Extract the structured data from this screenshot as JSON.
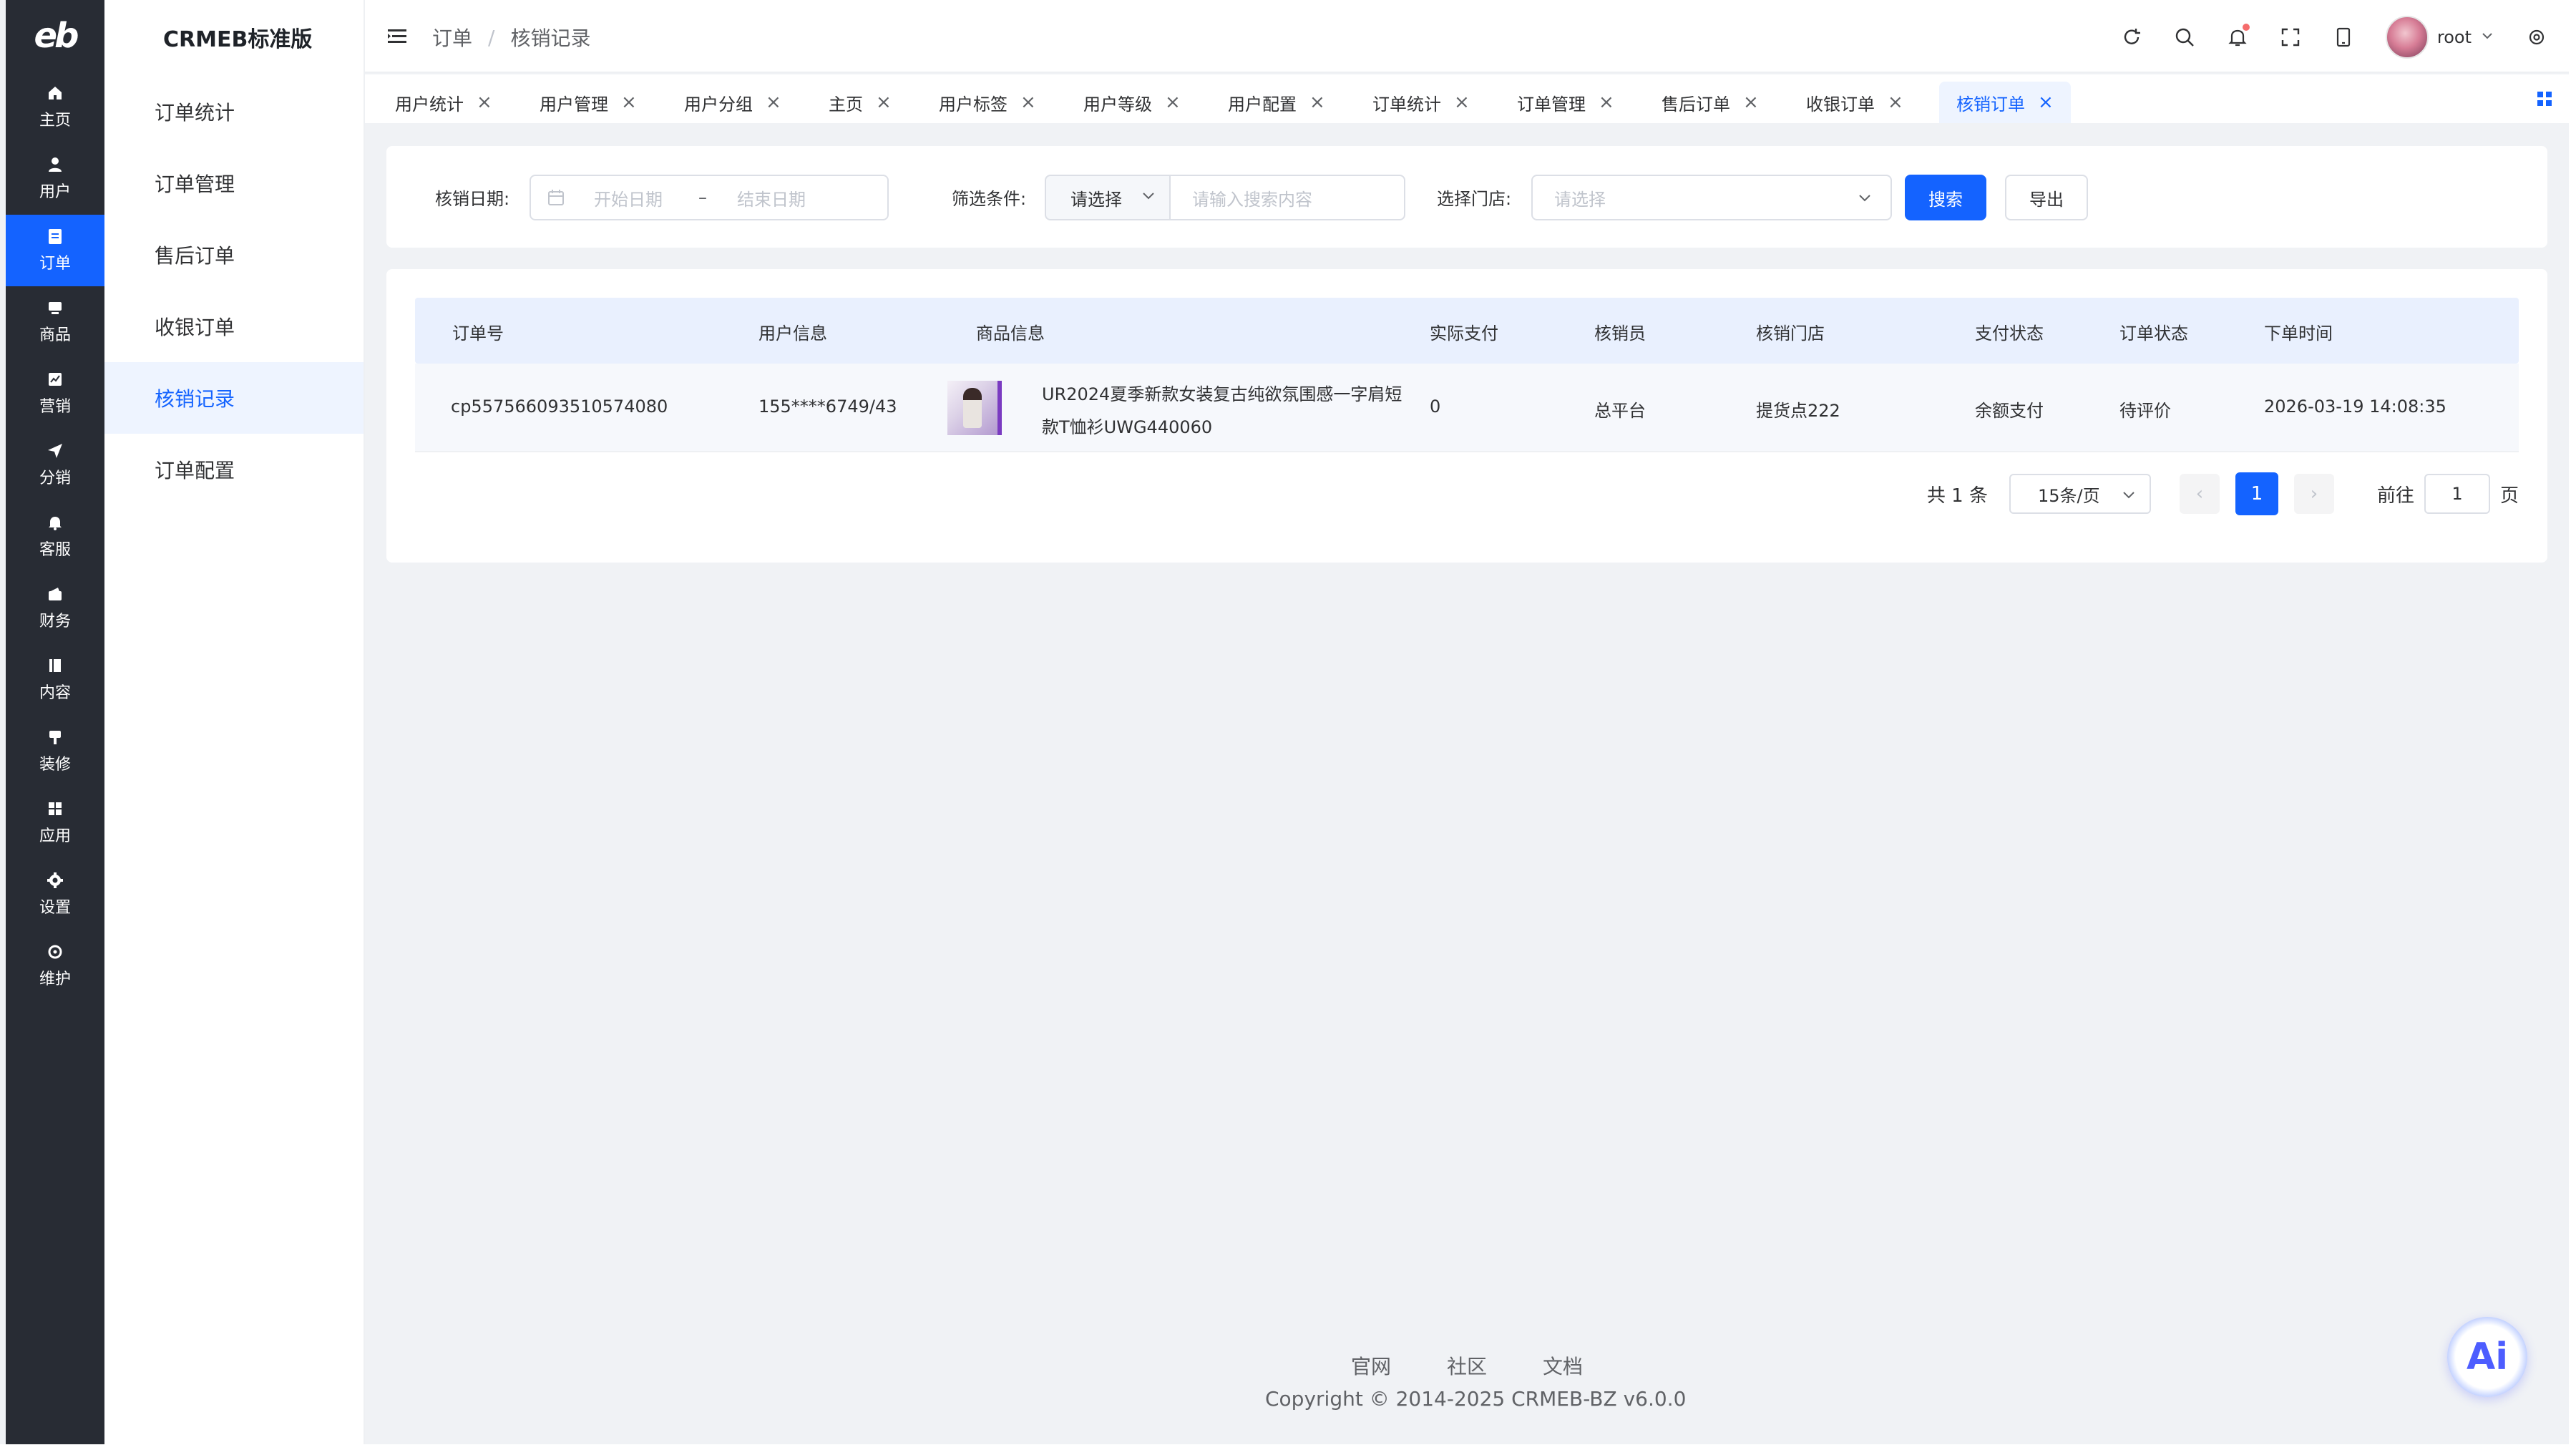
{
  "brand": {
    "logo_text": "eb",
    "title": "CRMEB标准版"
  },
  "rail": [
    {
      "label": "主页",
      "icon": "home-icon"
    },
    {
      "label": "用户",
      "icon": "user-icon"
    },
    {
      "label": "订单",
      "icon": "order-icon",
      "active": true
    },
    {
      "label": "商品",
      "icon": "product-icon"
    },
    {
      "label": "营销",
      "icon": "marketing-icon"
    },
    {
      "label": "分销",
      "icon": "send-icon"
    },
    {
      "label": "客服",
      "icon": "bell-icon"
    },
    {
      "label": "财务",
      "icon": "finance-icon"
    },
    {
      "label": "内容",
      "icon": "content-icon"
    },
    {
      "label": "装修",
      "icon": "decorate-icon"
    },
    {
      "label": "应用",
      "icon": "apps-icon"
    },
    {
      "label": "设置",
      "icon": "settings-icon"
    },
    {
      "label": "维护",
      "icon": "maintain-icon"
    }
  ],
  "subnav": [
    {
      "label": "订单统计"
    },
    {
      "label": "订单管理"
    },
    {
      "label": "售后订单"
    },
    {
      "label": "收银订单"
    },
    {
      "label": "核销记录",
      "active": true
    },
    {
      "label": "订单配置"
    }
  ],
  "breadcrumb": {
    "parent": "订单",
    "separator": "/",
    "current": "核销记录"
  },
  "header": {
    "username": "root"
  },
  "tabs": [
    {
      "label": "用户统计"
    },
    {
      "label": "用户管理"
    },
    {
      "label": "用户分组"
    },
    {
      "label": "主页"
    },
    {
      "label": "用户标签"
    },
    {
      "label": "用户等级"
    },
    {
      "label": "用户配置"
    },
    {
      "label": "订单统计"
    },
    {
      "label": "订单管理"
    },
    {
      "label": "售后订单"
    },
    {
      "label": "收银订单"
    },
    {
      "label": "核销订单",
      "active": true
    }
  ],
  "filters": {
    "date_label": "核销日期:",
    "start_placeholder": "开始日期",
    "range_separator": "–",
    "end_placeholder": "结束日期",
    "condition_label": "筛选条件:",
    "condition_value": "请选择",
    "search_placeholder": "请输入搜索内容",
    "store_label": "选择门店:",
    "store_placeholder": "请选择",
    "search_button": "搜索",
    "export_button": "导出"
  },
  "table": {
    "columns": [
      "订单号",
      "用户信息",
      "商品信息",
      "实际支付",
      "核销员",
      "核销门店",
      "支付状态",
      "订单状态",
      "下单时间"
    ],
    "rows": [
      {
        "order_no": "cp557566093510574080",
        "user": "155****6749/43",
        "product_line1": "UR2024夏季新款女装复古纯欲氛围感一字肩短",
        "product_line2": "款T恤衫UWG440060",
        "paid": "0",
        "clerk": "总平台",
        "store": "提货点222",
        "pay_status": "余额支付",
        "order_status": "待评价",
        "time": "2026-03-19 14:08:35"
      }
    ]
  },
  "pagination": {
    "total": "共 1 条",
    "page_size": "15条/页",
    "prev": "‹",
    "current_page": "1",
    "next": "›",
    "goto_label": "前往",
    "goto_value": "1",
    "page_unit": "页"
  },
  "footer": {
    "links": [
      "官网",
      "社区",
      "文档"
    ],
    "copyright": "Copyright © 2014-2025 CRMEB-BZ v6.0.0"
  },
  "ai_button": {
    "label": "Ai"
  },
  "colors": {
    "accent": "#1463ff",
    "rail_bg": "#282c34",
    "header_row_bg": "#e9f0fe"
  }
}
